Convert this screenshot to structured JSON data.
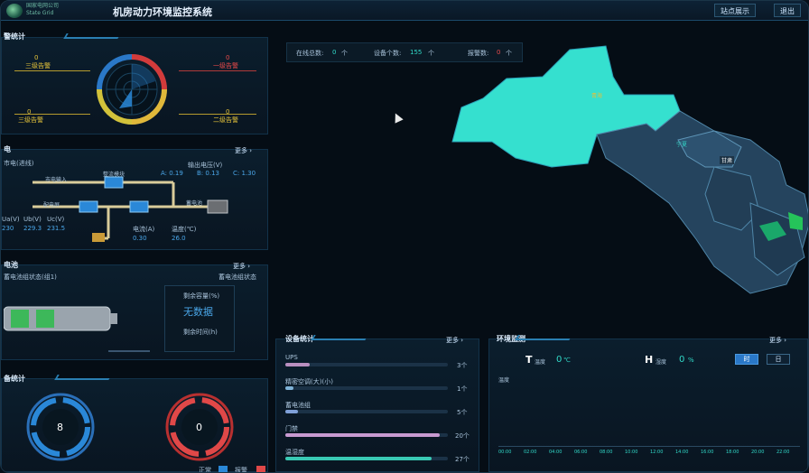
{
  "app": {
    "logo_line1": "国家电网公司",
    "logo_line2": "State Grid",
    "title": "机房动力环境监控系统",
    "btn_home": "站点展示",
    "btn_right": "退出"
  },
  "alarm_stats": {
    "title": "警统计",
    "level1": {
      "count": "0",
      "label": "一级告警"
    },
    "level2": {
      "count": "0",
      "label": "二级告警"
    },
    "level3": {
      "count": "0",
      "label": "三级告警"
    },
    "level4": {
      "count": "0",
      "label": "三级告警"
    }
  },
  "power": {
    "title": "电",
    "more": "更多",
    "source_label": "市电(进线)",
    "voltage_title": "输出电压(V)",
    "va": "A: 0.19",
    "vb": "B: 0.13",
    "vc": "C: 1.30",
    "node_labels": [
      "市电输入",
      "整流模块",
      "配电屏",
      "蓄电池"
    ],
    "readings_left": [
      "Ua(V)",
      "Ub(V)",
      "Uc(V)"
    ],
    "values_left": [
      "230",
      "229.3",
      "231.5"
    ],
    "readings_mid": [
      "电流(A)",
      "电压(V)"
    ],
    "values_mid": [
      "0.30",
      "53.0"
    ],
    "readings_mid2": [
      "温度(℃)",
      "湿度(%)"
    ],
    "values_mid2": [
      "26.0",
      "60.0"
    ]
  },
  "battery": {
    "title": "电池",
    "more": "更多",
    "sub_left": "蓄电池组状态(组1)",
    "sub_right": "蓄电池组状态",
    "item1_label": "剩余容量(%)",
    "item1_value": "无数据",
    "item2_label": "剩余时间(h)"
  },
  "device_stats": {
    "title": "备统计",
    "normal_count": "8",
    "alarm_count": "0",
    "legend_normal": "正常",
    "legend_alarm": "报警"
  },
  "stat_box": {
    "online_label": "在线总数:",
    "online_value": "0",
    "online_unit": "个",
    "total_label": "设备个数:",
    "total_value": "155",
    "total_unit": "个",
    "alarm_label": "报警数:",
    "alarm_value": "0",
    "alarm_unit": "个"
  },
  "map": {
    "labels": [
      "青海",
      "甘肃",
      "宁夏"
    ]
  },
  "dev_count": {
    "title": "设备统计",
    "more": "更多",
    "items": [
      {
        "name": "UPS",
        "value": "3个",
        "fraction": 0.15
      },
      {
        "name": "精密空调(大)(小)",
        "value": "1个",
        "fraction": 0.05
      },
      {
        "name": "蓄电池组",
        "value": "5个",
        "fraction": 0.08
      },
      {
        "name": "门禁",
        "value": "20个",
        "fraction": 0.95
      },
      {
        "name": "温湿度",
        "value": "27个",
        "fraction": 0.9
      }
    ],
    "colors": {
      "ups": "#b98fc0",
      "ac": "#7fb3d8",
      "bat": "#7fa0d8",
      "door": "#c89ad0",
      "th": "#39c9b4"
    }
  },
  "env": {
    "title": "环境监测",
    "more": "更多",
    "temp_letter": "T",
    "temp_label": "温度",
    "temp_value": "0",
    "temp_unit": "℃",
    "hum_letter": "H",
    "hum_label": "湿度",
    "hum_value": "0",
    "hum_unit": "%",
    "tab_h": "时",
    "tab_d": "日",
    "ylabel": "温度",
    "xticks": [
      "00:00",
      "02:00",
      "04:00",
      "06:00",
      "08:00",
      "10:00",
      "12:00",
      "14:00",
      "16:00",
      "18:00",
      "20:00",
      "22:00"
    ]
  },
  "colors": {
    "accent": "#2a7fb2",
    "cyan": "#31d9c8",
    "alarm": "#e84a4a",
    "warn": "#e3c23a"
  }
}
